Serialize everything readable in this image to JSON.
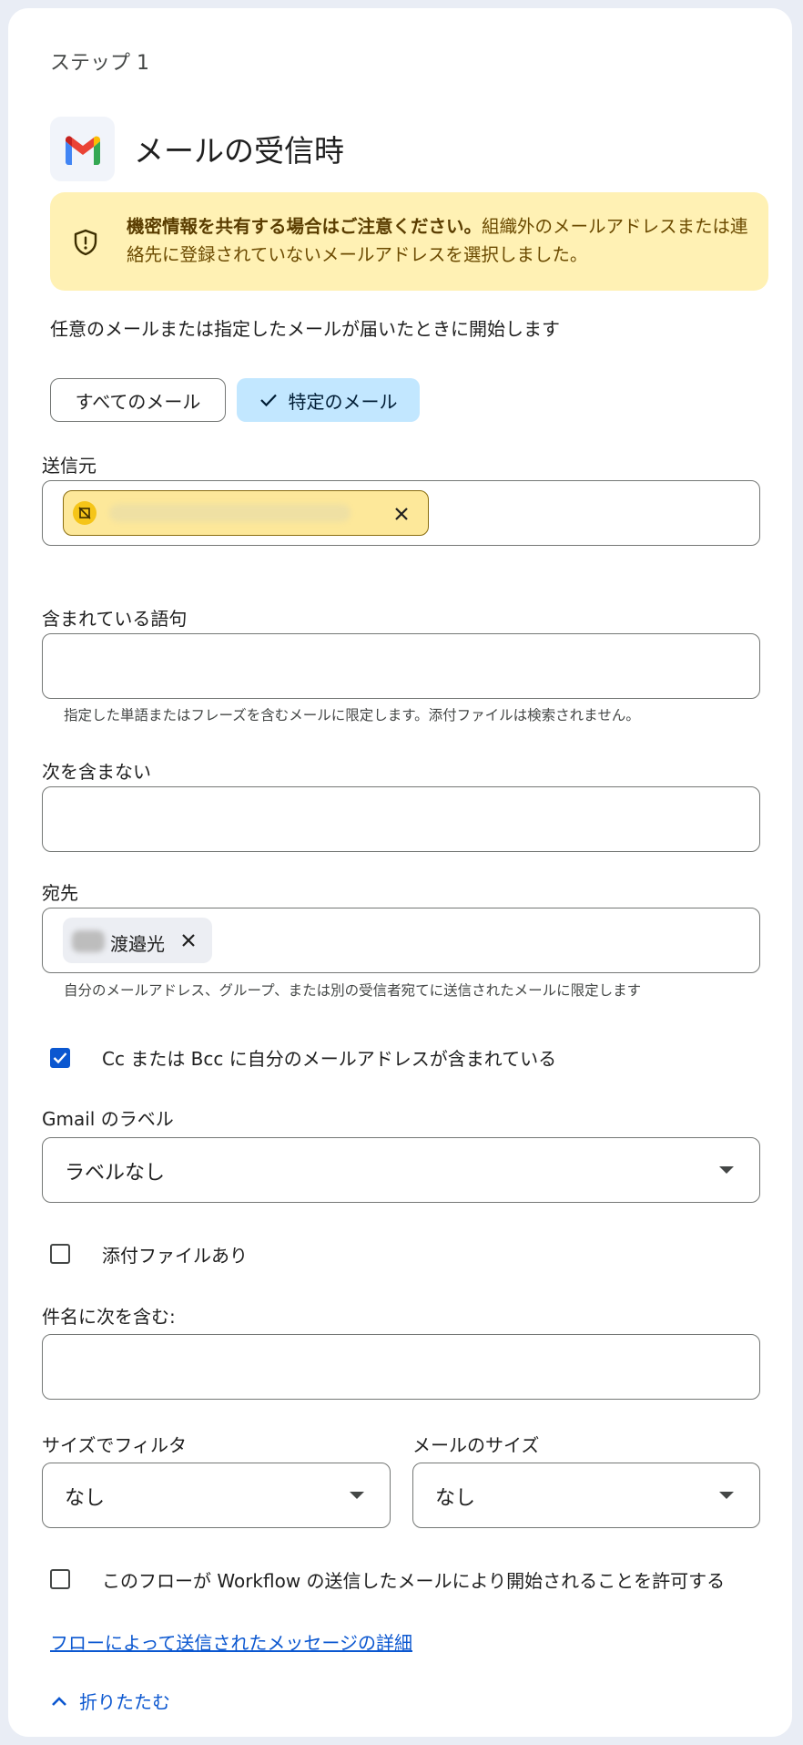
{
  "step": {
    "label": "ステップ 1"
  },
  "trigger": {
    "title": "メールの受信時"
  },
  "warning": {
    "bold_text": "機密情報を共有する場合はご注意ください。",
    "text": "組織外のメールアドレスまたは連絡先に登録されていないメールアドレスを選択しました。"
  },
  "description": "任意のメールまたは指定したメールが届いたときに開始します",
  "mode_chips": {
    "all_label": "すべてのメール",
    "specific_label": "特定のメール",
    "selected": "特定のメール"
  },
  "from": {
    "label": "送信元"
  },
  "includes": {
    "label": "含まれている語句",
    "value": "",
    "helper": "指定した単語またはフレーズを含むメールに限定します。添付ファイルは検索されません。"
  },
  "excludes": {
    "label": "次を含まない",
    "value": ""
  },
  "to": {
    "label": "宛先",
    "chip_name": "渡邉光",
    "helper": "自分のメールアドレス、グループ、または別の受信者宛てに送信されたメールに限定します"
  },
  "cc_bcc": {
    "label": "Cc または Bcc に自分のメールアドレスが含まれている",
    "checked": true
  },
  "gmail_label": {
    "label": "Gmail のラベル",
    "value": "ラベルなし"
  },
  "attachment": {
    "label": "添付ファイルあり",
    "checked": false
  },
  "subject": {
    "label": "件名に次を含む:",
    "value": ""
  },
  "size_filter": {
    "label": "サイズでフィルタ",
    "value": "なし"
  },
  "mail_size": {
    "label": "メールのサイズ",
    "value": "なし"
  },
  "allow_workflow": {
    "label": "このフローが Workflow の送信したメールにより開始されることを許可する",
    "checked": false
  },
  "details_link": "フローによって送信されたメッセージの詳細",
  "collapse_label": "折りたたむ",
  "colors": {
    "accent": "#0b57d0",
    "warning_bg": "#fff1b4",
    "selected_chip_bg": "#c2e7ff",
    "sender_chip_bg": "#fde89a"
  }
}
